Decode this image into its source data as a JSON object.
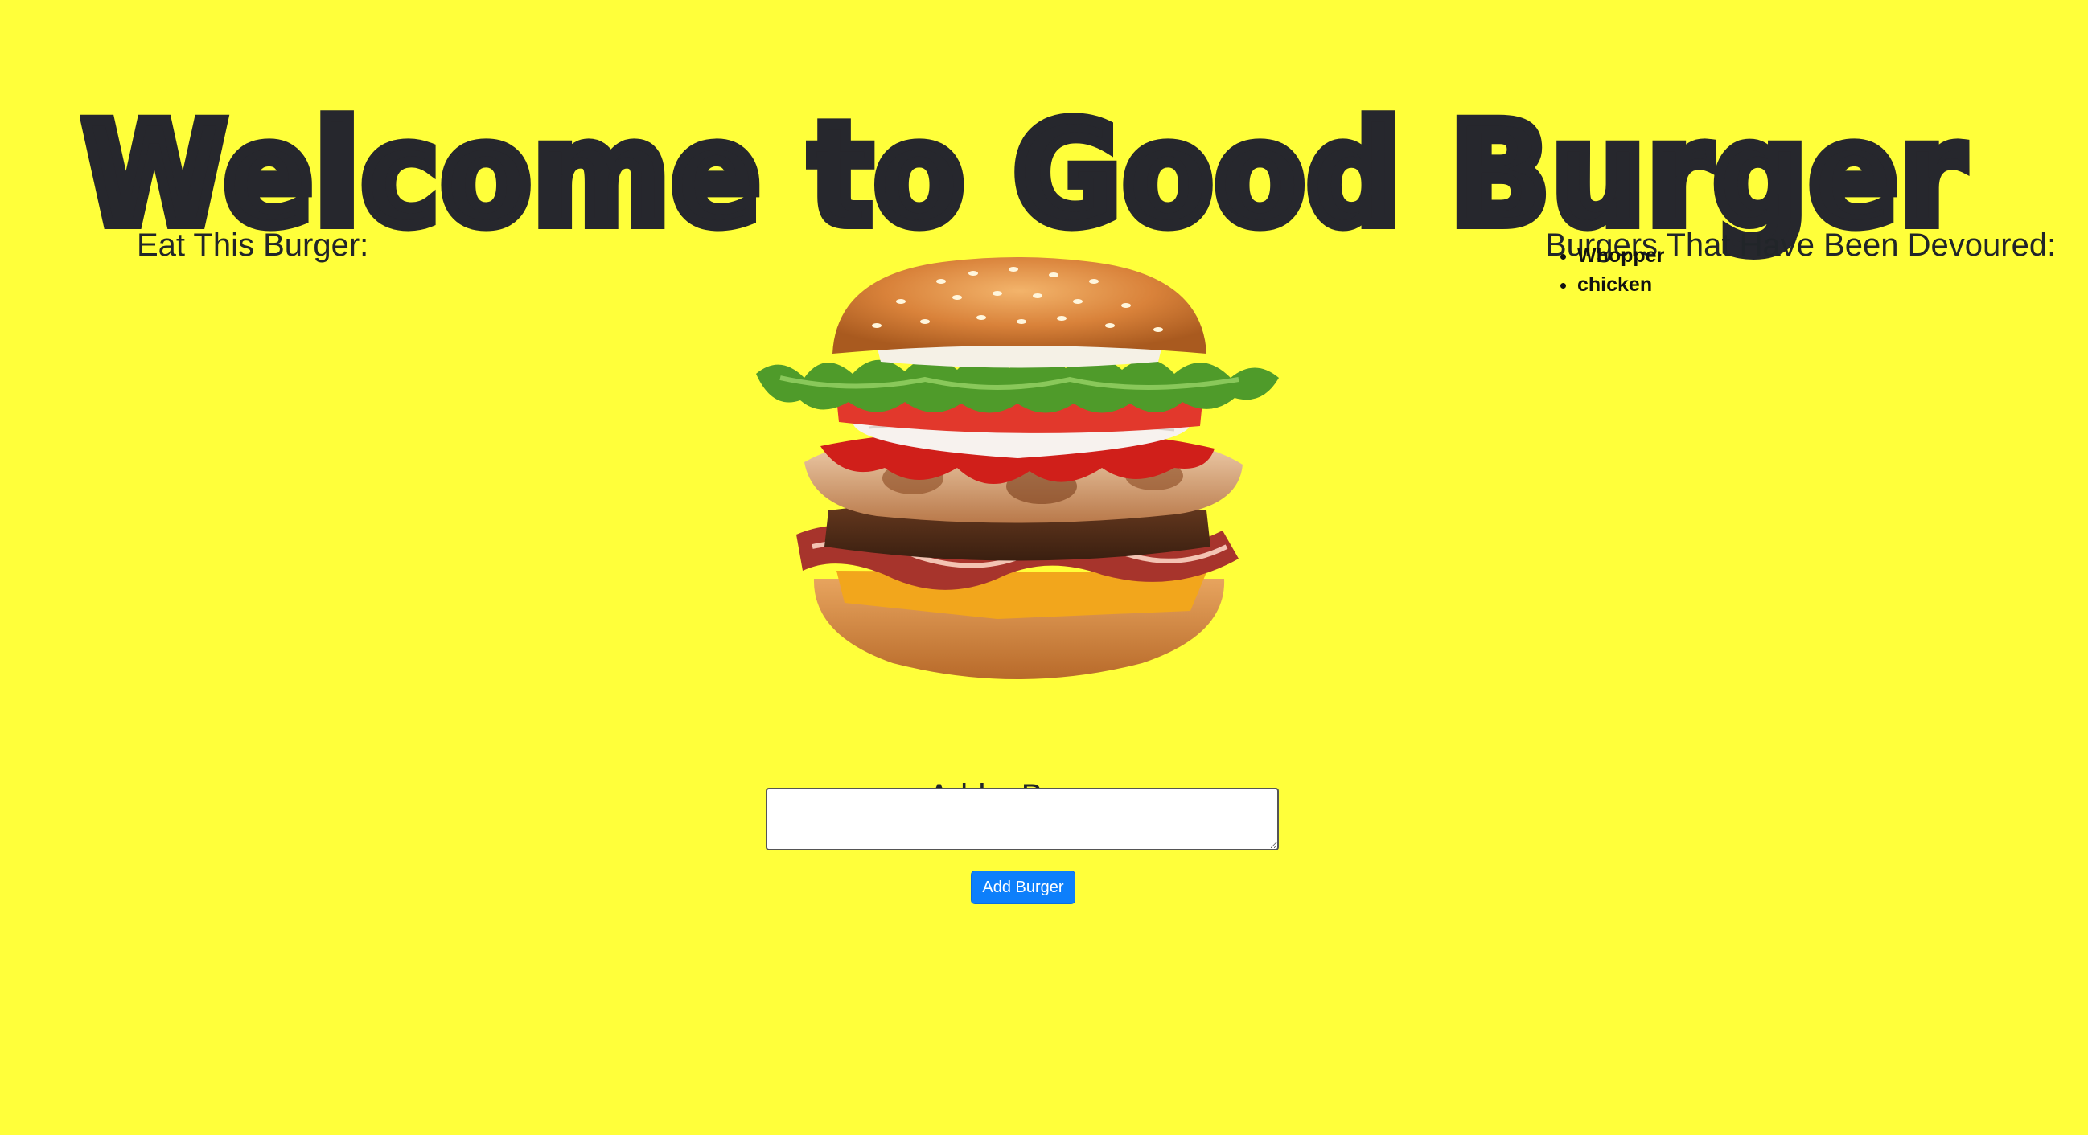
{
  "header": {
    "title": "Welcome to Good Burger"
  },
  "eat_column": {
    "heading": "Eat This Burger:"
  },
  "devoured_column": {
    "heading": "Burgers That Have Been Devoured:",
    "items": [
      "Whopper",
      "chicken"
    ]
  },
  "main": {
    "image_icon": "burger-image",
    "add_heading": "Add a Burger",
    "input_value": "",
    "button_label": "Add Burger"
  },
  "colors": {
    "background": "#ffff3a",
    "title": "#26272d",
    "button": "#0d7ffb"
  }
}
